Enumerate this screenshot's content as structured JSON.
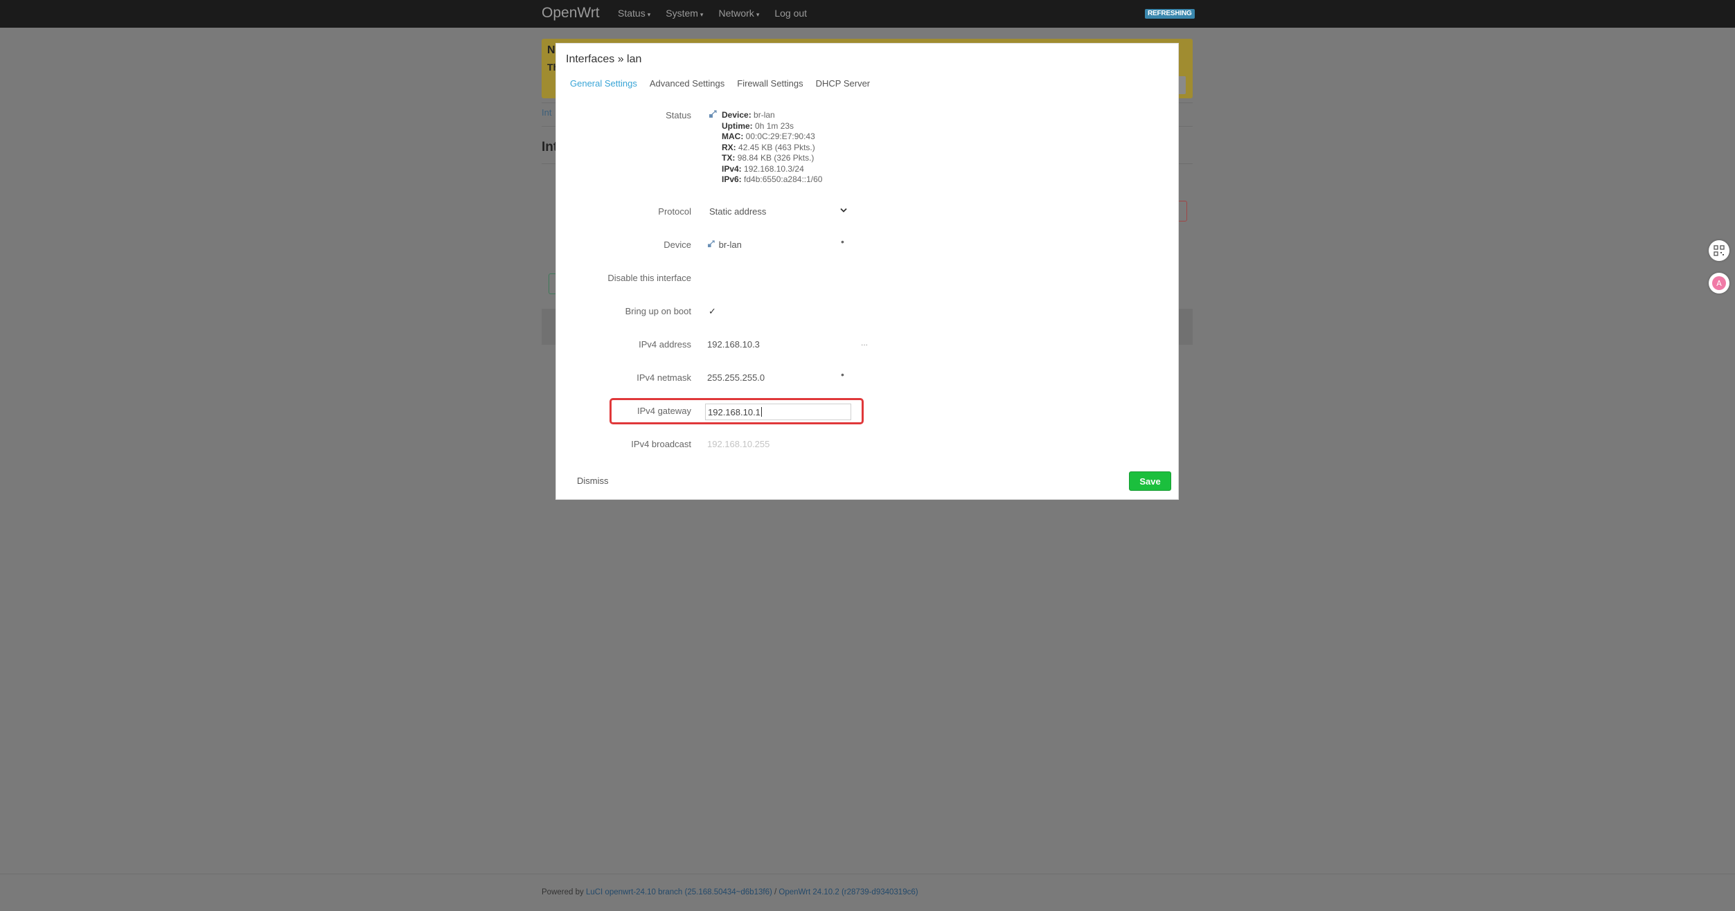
{
  "navbar": {
    "brand": "OpenWrt",
    "menu": [
      {
        "label": "Status",
        "has_caret": true
      },
      {
        "label": "System",
        "has_caret": true
      },
      {
        "label": "Network",
        "has_caret": true
      },
      {
        "label": "Log out",
        "has_caret": false
      }
    ],
    "caret": "▾",
    "refresh_badge": "REFRESHING"
  },
  "background": {
    "warning_title": "N",
    "warning_text": "Th",
    "tab_fragment": "Int",
    "heading_fragment": "Int"
  },
  "modal": {
    "title": "Interfaces » lan",
    "tabs": [
      {
        "label": "General Settings",
        "active": true
      },
      {
        "label": "Advanced Settings",
        "active": false
      },
      {
        "label": "Firewall Settings",
        "active": false
      },
      {
        "label": "DHCP Server",
        "active": false
      }
    ],
    "status": {
      "label": "Status",
      "icon": "network-device-icon",
      "lines": [
        {
          "key": "Device:",
          "value": "br-lan"
        },
        {
          "key": "Uptime:",
          "value": "0h 1m 23s"
        },
        {
          "key": "MAC:",
          "value": "00:0C:29:E7:90:43"
        },
        {
          "key": "RX:",
          "value": "42.45 KB (463 Pkts.)"
        },
        {
          "key": "TX:",
          "value": "98.84 KB (326 Pkts.)"
        },
        {
          "key": "IPv4:",
          "value": "192.168.10.3/24"
        },
        {
          "key": "IPv6:",
          "value": "fd4b:6550:a284::1/60"
        }
      ]
    },
    "fields": {
      "protocol": {
        "label": "Protocol",
        "value": "Static address"
      },
      "device": {
        "label": "Device",
        "value": "br-lan",
        "icon": "network-device-icon"
      },
      "disable": {
        "label": "Disable this interface",
        "checked": false
      },
      "bring_up": {
        "label": "Bring up on boot",
        "checked": true,
        "check": "✓"
      },
      "ipv4_address": {
        "label": "IPv4 address",
        "value": "192.168.10.3",
        "more": "..."
      },
      "ipv4_netmask": {
        "label": "IPv4 netmask",
        "value": "255.255.255.0"
      },
      "ipv4_gateway": {
        "label": "IPv4 gateway",
        "value": "192.168.10.1"
      },
      "ipv4_broadcast": {
        "label": "IPv4 broadcast",
        "placeholder": "192.168.10.255"
      }
    },
    "dismiss": "Dismiss",
    "save": "Save"
  },
  "footer": {
    "powered_by": "Powered by",
    "luci": "LuCI openwrt-24.10 branch (25.168.50434~d6b13f6)",
    "sep": "/",
    "openwrt": "OpenWrt 24.10.2 (r28739-d9340319c6)"
  },
  "colors": {
    "accent": "#38a4d6",
    "save": "#1bbf3d",
    "highlight": "#e0383a",
    "navbar": "#1b1b1b",
    "overlay": "#7a7a7a"
  }
}
